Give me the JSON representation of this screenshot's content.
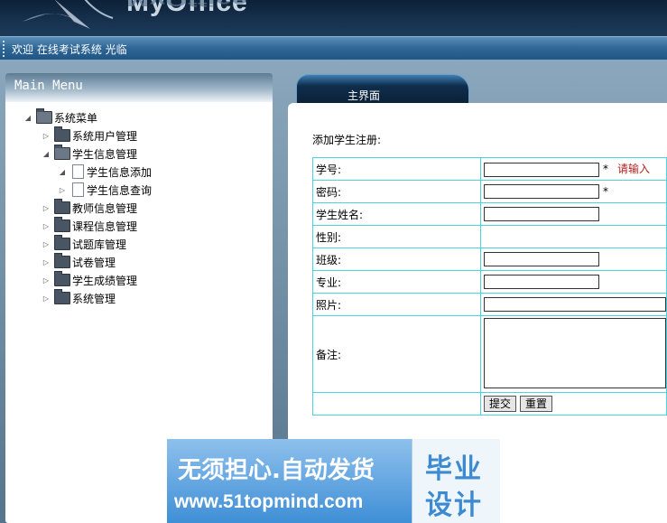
{
  "header": {
    "logo_text": "MyOffice",
    "welcome": "欢迎 在线考试系统 光临"
  },
  "menu": {
    "title": "Main Menu",
    "items": [
      {
        "label": "系统菜单"
      },
      {
        "label": "系统用户管理"
      },
      {
        "label": "学生信息管理"
      },
      {
        "label": "学生信息添加"
      },
      {
        "label": "学生信息查询"
      },
      {
        "label": "教师信息管理"
      },
      {
        "label": "课程信息管理"
      },
      {
        "label": "试题库管理"
      },
      {
        "label": "试卷管理"
      },
      {
        "label": "学生成绩管理"
      },
      {
        "label": "系统管理"
      }
    ]
  },
  "tab": {
    "label": "主界面"
  },
  "form": {
    "title": "添加学生注册:",
    "fields": [
      {
        "label": "学号:",
        "value": "",
        "required": "*",
        "hint": "请输入"
      },
      {
        "label": "密码:",
        "value": "",
        "required": "*"
      },
      {
        "label": "学生姓名:",
        "value": ""
      },
      {
        "label": "性别:"
      },
      {
        "label": "班级:",
        "value": ""
      },
      {
        "label": "专业:",
        "value": ""
      },
      {
        "label": "照片:",
        "value": ""
      },
      {
        "label": "备注:",
        "value": ""
      }
    ],
    "submit_label": "提交",
    "reset_label": "重置"
  },
  "watermark": {
    "line1": "无须担心.自动发货",
    "line2": "www.51topmind.com",
    "side_top": "毕业",
    "side_bottom": "设计"
  }
}
